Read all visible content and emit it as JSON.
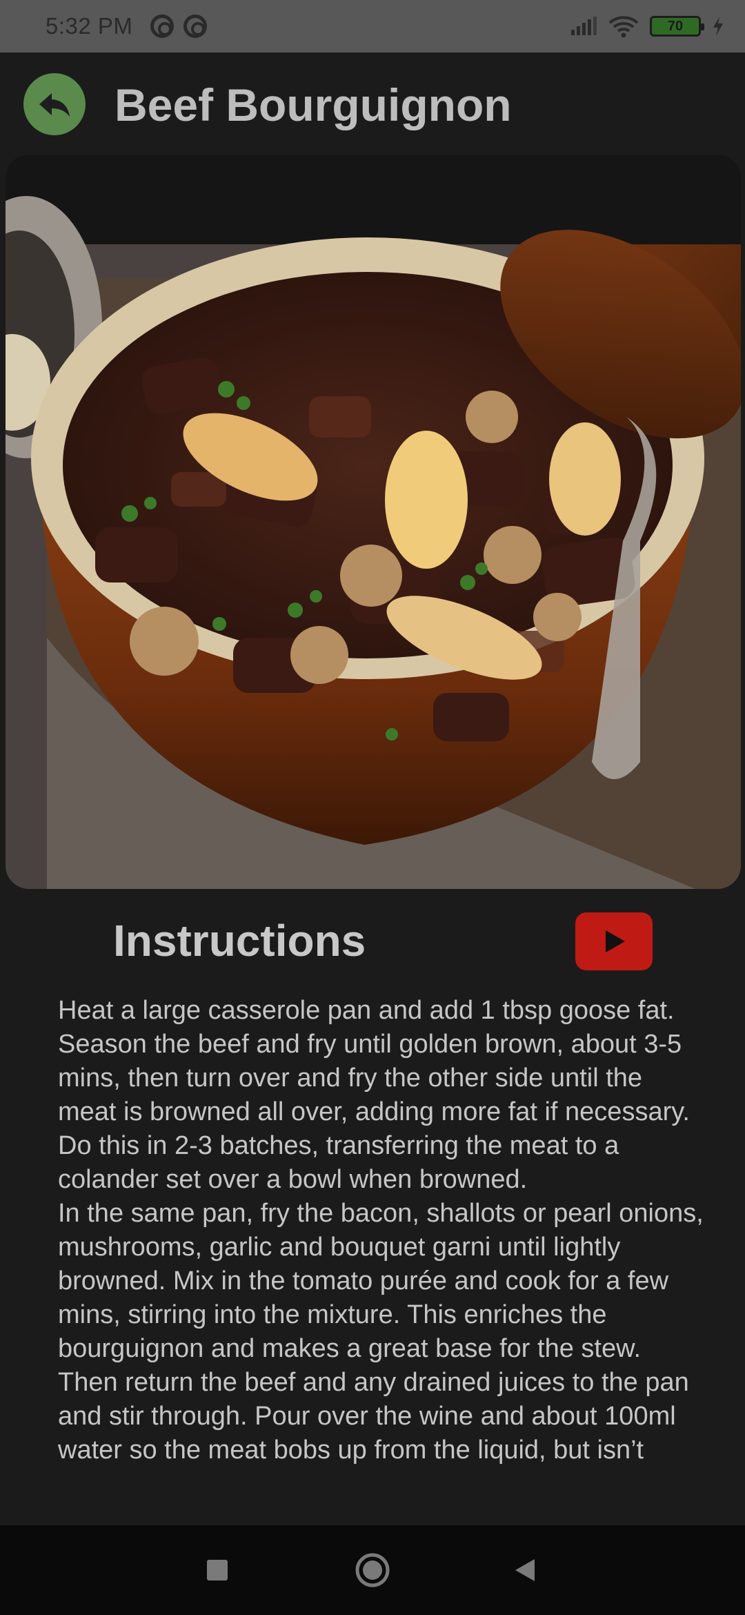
{
  "status_bar": {
    "time": "5:32 PM",
    "battery_level": "70"
  },
  "header": {
    "title": "Beef Bourguignon"
  },
  "hero_image": {
    "subject": "casserole-dish-with-beef-bourguignon"
  },
  "instructions": {
    "title": "Instructions",
    "paragraphs": [
      "Heat a large casserole pan and add 1 tbsp goose fat. Season the beef and fry until golden brown, about 3-5 mins, then turn over and fry the other side until the meat is browned all over, adding more fat if necessary. Do this in 2-3 batches, transferring the meat to a colander set over a bowl when browned.",
      "In the same pan, fry the bacon, shallots or pearl onions, mushrooms, garlic and bouquet garni until lightly browned. Mix in the tomato purée and cook for a few mins, stirring into the mixture. This enriches the bourguignon and makes a great base for the stew. Then return the beef and any drained juices to the pan and stir through. Pour over the wine and about 100ml water so the meat bobs up from the liquid, but isn’t"
    ]
  },
  "colors": {
    "accent_green": "#5a8a4c",
    "youtube_red": "#c01a14",
    "background": "#1b1b1b"
  },
  "nav": {
    "icons": [
      "recents-square-icon",
      "home-circle-icon",
      "back-triangle-icon"
    ]
  }
}
